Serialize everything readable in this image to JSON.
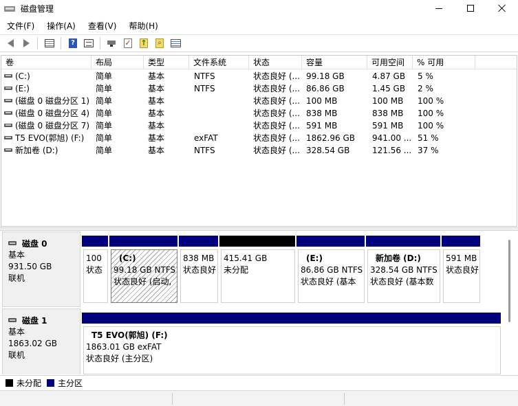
{
  "window": {
    "title": "磁盘管理"
  },
  "menu": [
    "文件(F)",
    "操作(A)",
    "查看(V)",
    "帮助(H)"
  ],
  "toolbar": {
    "icons": [
      "back-icon",
      "forward-icon",
      "list-view-icon",
      "help-icon",
      "properties-icon",
      "connect-icon",
      "check-icon",
      "up-folder-icon",
      "search-folder-icon",
      "detail-list-icon"
    ],
    "help_glyph": "?"
  },
  "table": {
    "headers": [
      "卷",
      "布局",
      "类型",
      "文件系统",
      "状态",
      "容量",
      "可用空间",
      "% 可用"
    ],
    "rows": [
      [
        "(C:)",
        "简单",
        "基本",
        "NTFS",
        "状态良好 (...",
        "99.18 GB",
        "4.87 GB",
        "5 %"
      ],
      [
        "(E:)",
        "简单",
        "基本",
        "NTFS",
        "状态良好 (...",
        "86.86 GB",
        "1.45 GB",
        "2 %"
      ],
      [
        "(磁盘 0 磁盘分区 1)",
        "简单",
        "基本",
        "",
        "状态良好 (...",
        "100 MB",
        "100 MB",
        "100 %"
      ],
      [
        "(磁盘 0 磁盘分区 4)",
        "简单",
        "基本",
        "",
        "状态良好 (...",
        "838 MB",
        "838 MB",
        "100 %"
      ],
      [
        "(磁盘 0 磁盘分区 7)",
        "简单",
        "基本",
        "",
        "状态良好 (...",
        "591 MB",
        "591 MB",
        "100 %"
      ],
      [
        "T5 EVO(郭旭) (F:)",
        "简单",
        "基本",
        "exFAT",
        "状态良好 (...",
        "1862.96 GB",
        "941.00 ...",
        "51 %"
      ],
      [
        "新加卷 (D:)",
        "简单",
        "基本",
        "NTFS",
        "状态良好 (...",
        "328.54 GB",
        "121.56 ...",
        "37 %"
      ]
    ]
  },
  "disks": [
    {
      "name": "磁盘 0",
      "type": "基本",
      "size": "931.50 GB",
      "status": "联机",
      "partitions": [
        {
          "lines": [
            "100",
            "状态"
          ],
          "bar": "primary"
        },
        {
          "lines": [
            "(C:)",
            "99.18 GB NTFS",
            "状态良好 (启动,"
          ],
          "bar": "primary",
          "hatched": true
        },
        {
          "lines": [
            "838 MB",
            "状态良好"
          ],
          "bar": "primary"
        },
        {
          "lines": [
            "415.41 GB",
            "未分配"
          ],
          "bar": "unallocated"
        },
        {
          "lines": [
            "(E:)",
            "86.86 GB NTFS",
            "状态良好 (基本"
          ],
          "bar": "primary"
        },
        {
          "lines": [
            "新加卷  (D:)",
            "328.54 GB NTFS",
            "状态良好 (基本数"
          ],
          "bar": "primary"
        },
        {
          "lines": [
            "591 MB",
            "状态良好"
          ],
          "bar": "primary"
        }
      ]
    },
    {
      "name": "磁盘 1",
      "type": "基本",
      "size": "1863.02 GB",
      "status": "联机",
      "partitions": [
        {
          "lines": [
            "T5 EVO(郭旭)  (F:)",
            "1863.01 GB exFAT",
            "状态良好 (主分区)"
          ],
          "bar": "primary"
        }
      ]
    }
  ],
  "legend": [
    {
      "label": "未分配",
      "color": "#000000"
    },
    {
      "label": "主分区",
      "color": "#00007d"
    }
  ]
}
